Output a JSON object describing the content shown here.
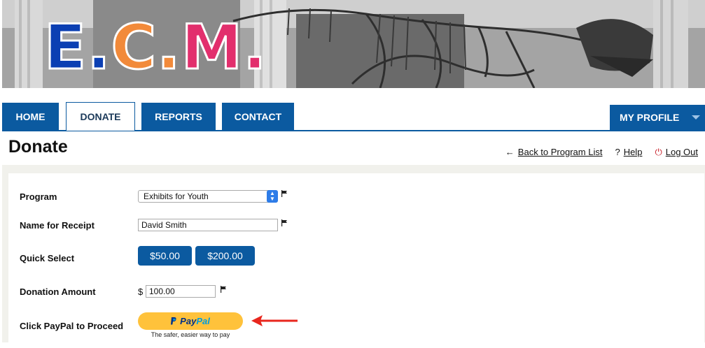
{
  "logo": {
    "letter1": "E",
    "dot1": ".",
    "letter2": "C",
    "dot2": ".",
    "letter3": "M",
    "dot3": "."
  },
  "nav": {
    "home": "HOME",
    "donate": "DONATE",
    "reports": "REPORTS",
    "contact": "CONTACT",
    "profile": "MY PROFILE"
  },
  "page": {
    "title": "Donate"
  },
  "links": {
    "back": "Back to Program List",
    "help": "Help",
    "logout": "Log Out"
  },
  "form": {
    "program_label": "Program",
    "program_value": "Exhibits for Youth",
    "name_label": "Name for Receipt",
    "name_value": "David Smith",
    "quick_label": "Quick Select",
    "quick_options": [
      "$50.00",
      "$200.00"
    ],
    "amount_label": "Donation Amount",
    "currency": "$",
    "amount_value": "100.00",
    "paypal_label": "Click PayPal to Proceed",
    "paypal_pay": "Pay",
    "paypal_pal": "Pal",
    "paypal_tagline": "The safer, easier way to pay"
  },
  "colors": {
    "nav": "#0b5aa0",
    "e": "#0b3fb3",
    "c": "#f28a3a",
    "m": "#e22f6d",
    "paypal": "#ffc23b",
    "arrow": "#e8261d"
  }
}
